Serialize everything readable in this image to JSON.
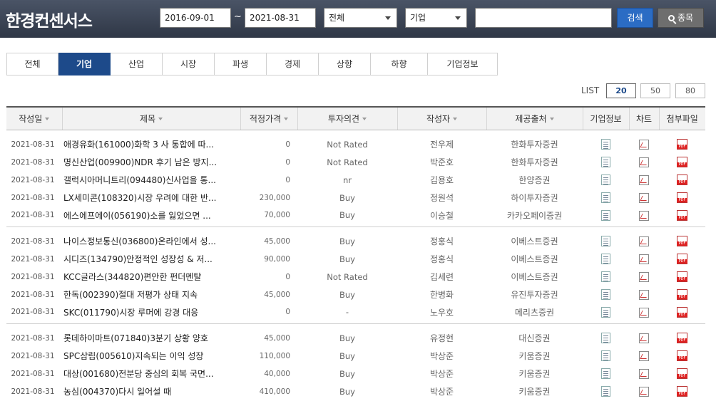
{
  "header": {
    "brand": "한경컨센서스",
    "date_from": "2016-09-01",
    "date_sep": "~",
    "date_to": "2021-08-31",
    "select_scope": "전체",
    "select_category": "기업",
    "search_value": "",
    "search_label": "검색",
    "stock_label": "종목"
  },
  "tabs": [
    "전체",
    "기업",
    "산업",
    "시장",
    "파생",
    "경제",
    "상향",
    "하향",
    "기업정보"
  ],
  "active_tab": "기업",
  "list": {
    "label": "LIST",
    "sizes": [
      "20",
      "50",
      "80"
    ],
    "active": "20"
  },
  "columns": [
    "작성일",
    "제목",
    "적정가격",
    "투자의견",
    "작성자",
    "제공출처",
    "기업정보",
    "차트",
    "첨부파일"
  ],
  "rows": [
    {
      "date": "2021-08-31",
      "title": "애경유화(161000)화학 3 사 통합에 따...",
      "price": "0",
      "opinion": "Not Rated",
      "author": "전우제",
      "source": "한화투자증권"
    },
    {
      "date": "2021-08-31",
      "title": "명신산업(009900)NDR 후기 남은 방지...",
      "price": "0",
      "opinion": "Not Rated",
      "author": "박준호",
      "source": "한화투자증권"
    },
    {
      "date": "2021-08-31",
      "title": "갤럭시아머니트리(094480)신사업을 통...",
      "price": "0",
      "opinion": "nr",
      "author": "김용호",
      "source": "한양증권"
    },
    {
      "date": "2021-08-31",
      "title": "LX세미콘(108320)시장 우려에 대한 반...",
      "price": "230,000",
      "opinion": "Buy",
      "author": "정원석",
      "source": "하이투자증권"
    },
    {
      "date": "2021-08-31",
      "title": "에스에프에이(056190)소를 잃었으면 ...",
      "price": "70,000",
      "opinion": "Buy",
      "author": "이승철",
      "source": "카카오페이증권"
    },
    {
      "date": "2021-08-31",
      "title": "나이스정보통신(036800)온라인에서 성...",
      "price": "45,000",
      "opinion": "Buy",
      "author": "정홍식",
      "source": "이베스트증권"
    },
    {
      "date": "2021-08-31",
      "title": "시디즈(134790)안정적인 성장성 & 저...",
      "price": "90,000",
      "opinion": "Buy",
      "author": "정홍식",
      "source": "이베스트증권"
    },
    {
      "date": "2021-08-31",
      "title": "KCC글라스(344820)편안한 펀더멘탈",
      "price": "0",
      "opinion": "Not Rated",
      "author": "김세련",
      "source": "이베스트증권"
    },
    {
      "date": "2021-08-31",
      "title": "한독(002390)절대 저평가 상태 지속",
      "price": "45,000",
      "opinion": "Buy",
      "author": "한병화",
      "source": "유진투자증권"
    },
    {
      "date": "2021-08-31",
      "title": "SKC(011790)시장 루머에 강경 대응",
      "price": "0",
      "opinion": "-",
      "author": "노우호",
      "source": "메리츠증권"
    },
    {
      "date": "2021-08-31",
      "title": "롯데하이마트(071840)3분기 상황 양호",
      "price": "45,000",
      "opinion": "Buy",
      "author": "유정현",
      "source": "대신증권"
    },
    {
      "date": "2021-08-31",
      "title": "SPC삼립(005610)지속되는 이익 성장",
      "price": "110,000",
      "opinion": "Buy",
      "author": "박상준",
      "source": "키움증권"
    },
    {
      "date": "2021-08-31",
      "title": "대상(001680)전분당 중심의 회복 국면...",
      "price": "40,000",
      "opinion": "Buy",
      "author": "박상준",
      "source": "키움증권"
    },
    {
      "date": "2021-08-31",
      "title": "농심(004370)다시 일어설 때",
      "price": "410,000",
      "opinion": "Buy",
      "author": "박상준",
      "source": "키움증권"
    }
  ]
}
